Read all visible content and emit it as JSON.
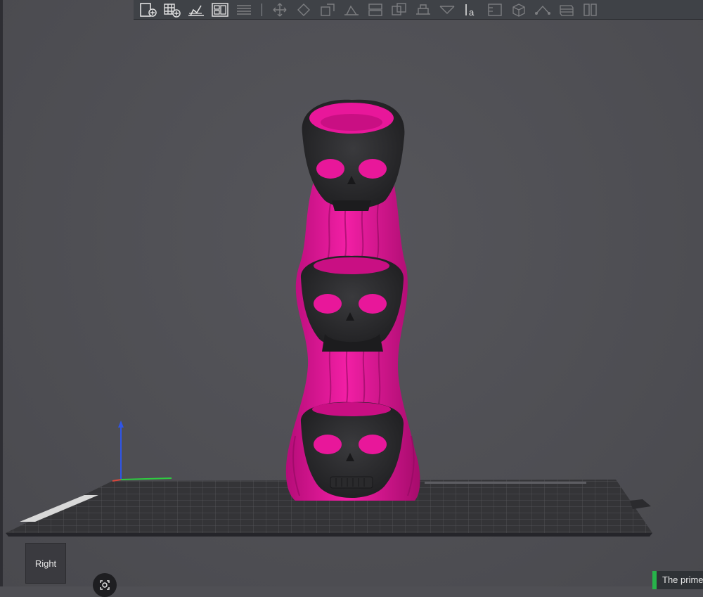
{
  "toolbar": {
    "items": [
      {
        "name": "add-model-icon",
        "enabled": true
      },
      {
        "name": "add-plate-icon",
        "enabled": true
      },
      {
        "name": "auto-orient-icon",
        "enabled": true
      },
      {
        "name": "arrange-icon",
        "enabled": true
      },
      {
        "name": "split-plate-icon",
        "enabled": false
      },
      {
        "name": "move-icon",
        "enabled": false
      },
      {
        "name": "rotate-icon",
        "enabled": false
      },
      {
        "name": "scale-icon",
        "enabled": false
      },
      {
        "name": "lay-on-face-icon",
        "enabled": false
      },
      {
        "name": "cut-icon",
        "enabled": false
      },
      {
        "name": "mesh-boolean-icon",
        "enabled": false
      },
      {
        "name": "support-paint-icon",
        "enabled": false
      },
      {
        "name": "seam-paint-icon",
        "enabled": false
      },
      {
        "name": "text-emboss-icon",
        "enabled": true
      },
      {
        "name": "measure-icon",
        "enabled": false
      },
      {
        "name": "assembly-icon",
        "enabled": false
      },
      {
        "name": "variable-layer-icon",
        "enabled": false
      },
      {
        "name": "slice-view-icon",
        "enabled": false
      }
    ],
    "text_tool_glyph": "a"
  },
  "view_cube": {
    "label": "Right"
  },
  "notification": {
    "text": "The prime",
    "status_color": "#27b34a"
  },
  "model": {
    "primary_color": "#e8179a",
    "secondary_color": "#2a2a2c",
    "description_name": "stacked skull tower"
  },
  "colors": {
    "viewport_bg": "#4f4f54",
    "bed": "#3a3a3d",
    "axis_x": "#2ecc40",
    "axis_z": "#2f55e8"
  }
}
